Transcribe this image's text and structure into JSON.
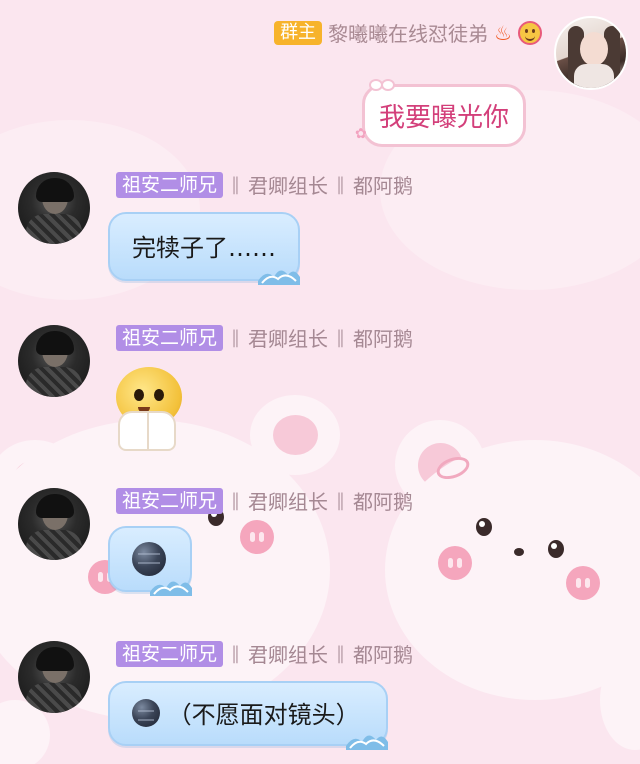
{
  "self_message": {
    "badge": "群主",
    "sender_name": "黎曦曦在线怼徒弟",
    "text": "我要曝光你"
  },
  "messages": [
    {
      "title": "祖安二师兄",
      "separator": "‖",
      "tag1": "君卿组长",
      "tag2": "都阿鹅",
      "content_type": "text",
      "text": "完犊子了……"
    },
    {
      "title": "祖安二师兄",
      "separator": "‖",
      "tag1": "君卿组长",
      "tag2": "都阿鹅",
      "content_type": "sticker",
      "sticker": "covering-face-emoji"
    },
    {
      "title": "祖安二师兄",
      "separator": "‖",
      "tag1": "君卿组长",
      "tag2": "都阿鹅",
      "content_type": "emoji",
      "emoji": "dark-ball-icon"
    },
    {
      "title": "祖安二师兄",
      "separator": "‖",
      "tag1": "君卿组长",
      "tag2": "都阿鹅",
      "content_type": "emoji-text",
      "emoji": "dark-ball-icon",
      "text": "（不愿面对镜头）"
    }
  ],
  "colors": {
    "background": "#fbe6ef",
    "owner_badge": "#f7b32b",
    "title_badge": "#b18ee6",
    "pink_bubble_text": "#d33f7a",
    "blue_bubble": "#c9e5fd"
  }
}
